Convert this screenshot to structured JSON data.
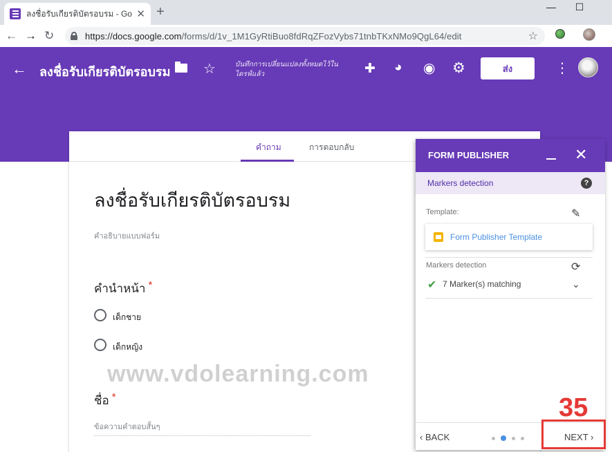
{
  "browser": {
    "tab_title": "ลงชื่อรับเกียรติบัตรอบรม - Google Forms",
    "tab_close": "✕",
    "new_tab": "+",
    "url_host": "https://docs.google.com",
    "url_path": "/forms/d/1v_1M1GyRtiBuo8fdRqZFozVybs71tnbTKxNMo9QgL64/edit",
    "window_minimize": "—",
    "window_maximize": "☐"
  },
  "header": {
    "title": "ลงชื่อรับเกียรติบัตรอบรม",
    "save_note": "บันทึกการเปลี่ยนแปลงทั้งหมดไว้ในไดรฟ์แล้ว",
    "send_label": "ส่ง",
    "accent_color": "#673ab7"
  },
  "form": {
    "tabs": [
      "คำถาม",
      "การตอบกลับ"
    ],
    "title": "ลงชื่อรับเกียรติบัตรอบรม",
    "description_placeholder": "คำอธิบายแบบฟอร์ม",
    "questions": [
      {
        "title": "คำนำหน้า",
        "required": "*",
        "options": [
          "เด็กชาย",
          "เด็กหญิง"
        ]
      },
      {
        "title": "ชื่อ",
        "required": "*",
        "answer_placeholder": "ข้อความคำตอบสั้นๆ"
      }
    ]
  },
  "watermark": "www.vdolearning.com",
  "form_publisher": {
    "title": "FORM PUBLISHER",
    "subheader": "Markers detection",
    "help": "?",
    "template_label": "Template:",
    "template_name": "Form Publisher Template",
    "markers_label": "Markers detection",
    "markers_status": "7 Marker(s) matching",
    "back_label": "BACK",
    "next_label": "NEXT",
    "page_indicator": {
      "current": 2,
      "total": 4
    }
  },
  "annotation": {
    "step_number": "35",
    "highlight_color": "#e53935"
  },
  "icons": [
    "back-arrow-icon",
    "forward-arrow-icon",
    "reload-icon",
    "lock-icon",
    "star-icon",
    "folder-icon",
    "puzzle-icon",
    "palette-icon",
    "eye-icon",
    "gear-icon",
    "more-vert-icon",
    "pencil-icon",
    "refresh-icon",
    "check-icon",
    "chevron-down-icon",
    "help-icon",
    "close-icon",
    "minimize-icon"
  ]
}
